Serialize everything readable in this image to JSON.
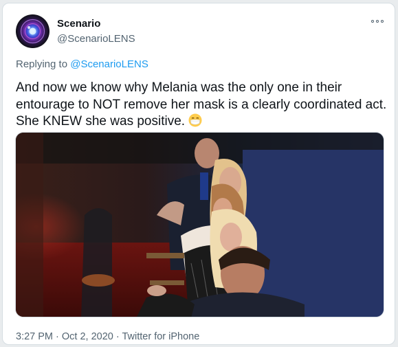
{
  "tweet": {
    "display_name": "Scenario",
    "handle": "@ScenarioLENS",
    "replying_prefix": "Replying to",
    "replying_to": "@ScenarioLENS",
    "text": "And now we know why Melania was the only one in their entourage to NOT remove her mask is a clearly coordinated act. She KNEW she was positive.",
    "emoji": "😷",
    "timestamp": "3:27 PM · Oct 2, 2020 · Twitter for iPhone"
  },
  "icons": {
    "more": "more-options-icon",
    "emoji": "face-with-medical-mask"
  }
}
